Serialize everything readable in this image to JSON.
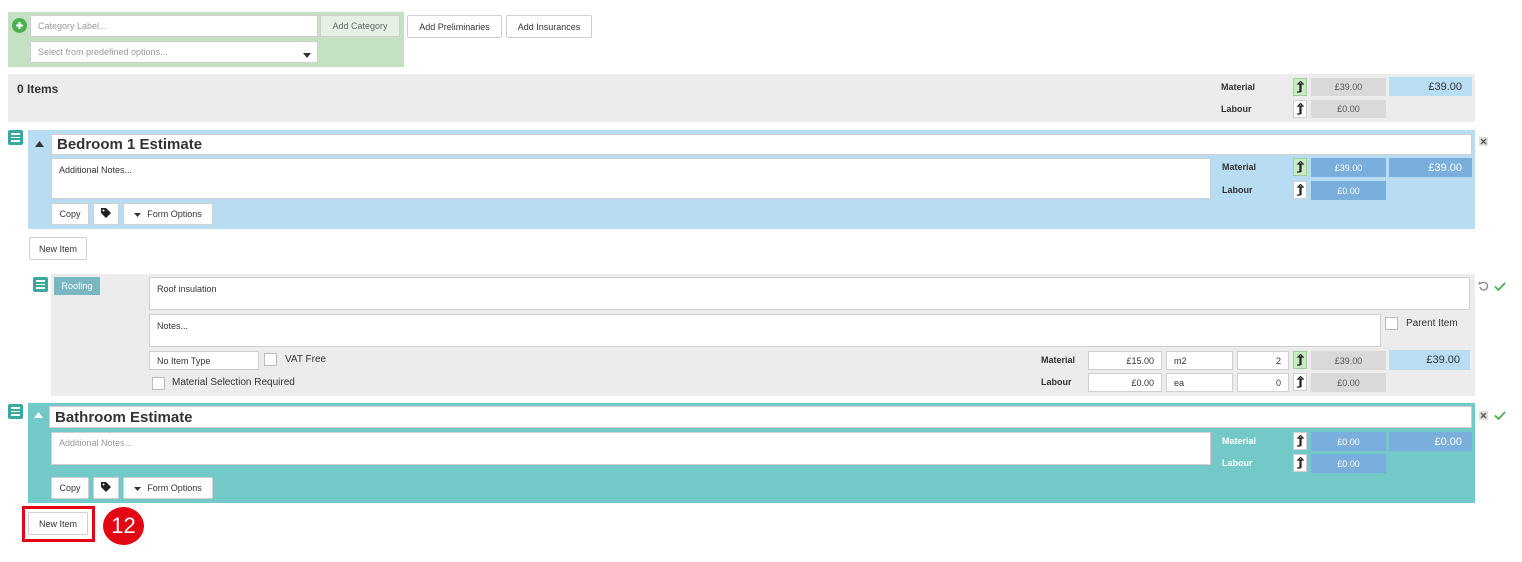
{
  "category_bar": {
    "label_placeholder": "Category Label...",
    "add_category_label": "Add Category",
    "select_placeholder": "Select from predefined options...",
    "add_preliminaries_label": "Add Preliminaries",
    "add_insurances_label": "Add Insurances"
  },
  "summary": {
    "items_count": "0 Items",
    "material_label": "Material",
    "labour_label": "Labour",
    "material_value": "£39.00",
    "labour_value": "£0.00",
    "total_value": "£39.00"
  },
  "bedroom": {
    "title": "Bedroom 1 Estimate",
    "notes_placeholder": "Additional Notes...",
    "material_label": "Material",
    "labour_label": "Labour",
    "material_value": "£39.00",
    "labour_value": "£0.00",
    "total_value": "£39.00",
    "copy_label": "Copy",
    "form_options_label": "Form Options"
  },
  "new_item_label": "New Item",
  "roof_item": {
    "category_badge": "Roofing",
    "description": "Roof insulation",
    "notes_placeholder": "Notes...",
    "parent_item_label": "Parent Item",
    "item_type": "No Item Type",
    "vat_free_label": "VAT Free",
    "material_selection_label": "Material Selection Required",
    "material_label": "Material",
    "labour_label": "Labour",
    "material_rate": "£15.00",
    "material_unit": "m2",
    "material_qty": "2",
    "material_total": "£39.00",
    "labour_rate": "£0.00",
    "labour_unit": "ea",
    "labour_qty": "0",
    "labour_total": "£0.00",
    "grand_total": "£39.00"
  },
  "bathroom": {
    "title": "Bathroom Estimate",
    "notes_placeholder": "Additional Notes...",
    "material_label": "Material",
    "labour_label": "Labour",
    "material_value": "£0.00",
    "labour_value": "£0.00",
    "total_value": "£0.00",
    "copy_label": "Copy",
    "form_options_label": "Form Options"
  },
  "step_badge": "12",
  "colors": {
    "category_bg": "#c5e1c3",
    "summary_bg": "#ececec",
    "bedroom_bg": "#b8dcf2",
    "bathroom_bg": "#72c9c7",
    "money_blue": "#7aaedc",
    "total_blue": "#b9def4",
    "highlight_red": "#e30613",
    "accent_teal": "#3aa7a0"
  },
  "icons": [
    "plus-circle-icon",
    "caret-down-icon",
    "arrow-up-icon",
    "menu-icon",
    "caret-up-icon",
    "close-icon",
    "tag-icon",
    "undo-icon",
    "check-icon"
  ]
}
